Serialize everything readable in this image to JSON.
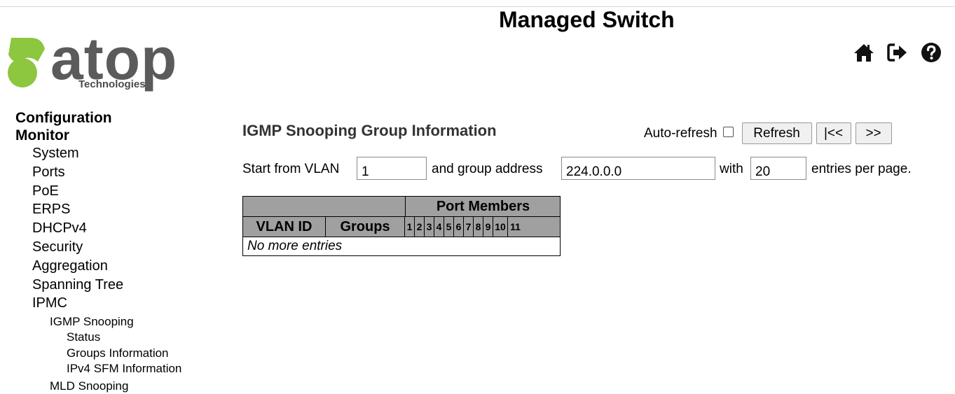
{
  "header": {
    "title": "Managed Switch",
    "logo": {
      "word": "atop",
      "sub": "Technologies",
      "colors": {
        "green": "#8dc63f",
        "gray": "#5b5b5b"
      }
    },
    "icons": [
      "home-icon",
      "logout-icon",
      "help-icon"
    ]
  },
  "sidebar": {
    "configuration": "Configuration",
    "monitor": "Monitor",
    "items": {
      "system": "System",
      "ports": "Ports",
      "poe": "PoE",
      "erps": "ERPS",
      "dhcpv4": "DHCPv4",
      "security": "Security",
      "aggregation": "Aggregation",
      "spanning_tree": "Spanning Tree",
      "ipmc": "IPMC",
      "igmp_snooping": "IGMP Snooping",
      "status": "Status",
      "groups_information": "Groups Information",
      "ipv4_sfm_information": "IPv4 SFM Information",
      "mld_snooping": "MLD Snooping"
    }
  },
  "main": {
    "heading": "IGMP Snooping Group Information",
    "auto_refresh_label": "Auto-refresh",
    "auto_refresh_checked": false,
    "buttons": {
      "refresh": "Refresh",
      "first": "|<<",
      "next": ">>"
    },
    "filter": {
      "start_label": "Start from VLAN",
      "vlan_value": "1",
      "group_label": "and group address",
      "group_value": "224.0.0.0",
      "with_label": "with",
      "entries_value": "20",
      "entries_label": "entries per page."
    },
    "table": {
      "port_members_header": "Port Members",
      "col_vlan_id": "VLAN ID",
      "col_groups": "Groups",
      "ports": [
        "1",
        "2",
        "3",
        "4",
        "5",
        "6",
        "7",
        "8",
        "9",
        "10",
        "11"
      ],
      "empty_message": "No more entries"
    }
  }
}
